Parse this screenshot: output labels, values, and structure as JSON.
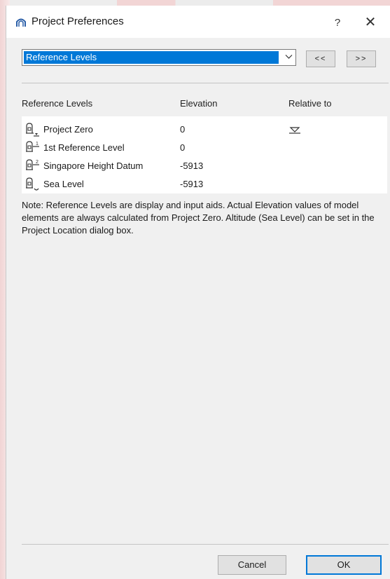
{
  "window": {
    "title": "Project Preferences",
    "help_label": "?",
    "close_label": "✕"
  },
  "panel_select": {
    "value": "Reference Levels"
  },
  "nav": {
    "prev_label": "<<",
    "next_label": ">>"
  },
  "table": {
    "headers": {
      "name": "Reference Levels",
      "elevation": "Elevation",
      "relative": "Relative to"
    },
    "rows": [
      {
        "name": "Project Zero",
        "elevation": "0",
        "icon": "project-zero-icon",
        "relative_icon": "level-marker-icon"
      },
      {
        "name": "1st Reference Level",
        "elevation": "0",
        "icon": "reference-level-1-icon"
      },
      {
        "name": "Singapore Height Datum",
        "elevation": "-5913",
        "icon": "reference-level-2-icon"
      },
      {
        "name": "Sea Level",
        "elevation": "-5913",
        "icon": "sea-level-icon"
      }
    ]
  },
  "note": "Note: Reference Levels are display and input aids. Actual Elevation values of model elements are always calculated from Project Zero. Altitude (Sea Level) can be set in the Project Location dialog box.",
  "footer": {
    "cancel_label": "Cancel",
    "ok_label": "OK"
  },
  "colors": {
    "accent": "#0078d7",
    "dialog_bg": "#f0f0f0",
    "background_tint": "#f2d5d5"
  }
}
